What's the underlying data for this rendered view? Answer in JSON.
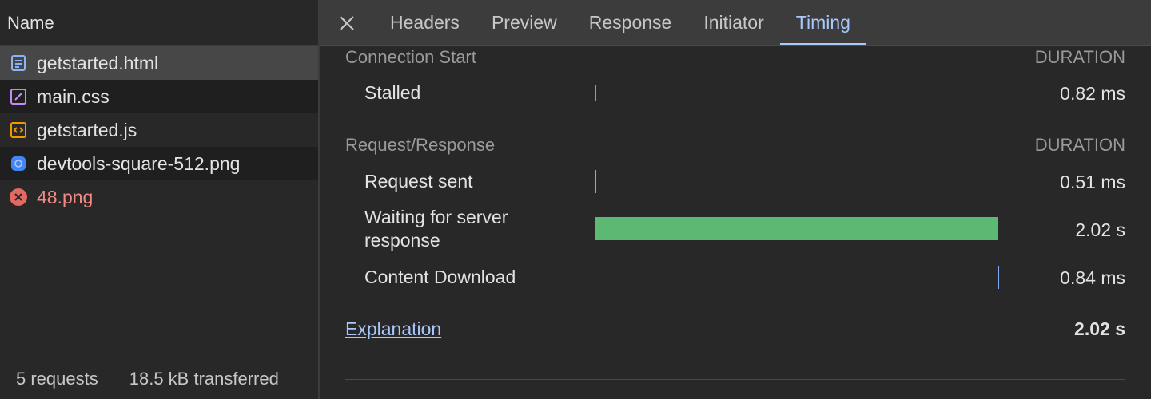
{
  "requests_panel": {
    "header": "Name",
    "items": [
      {
        "name": "getstarted.html",
        "icon": "document-icon",
        "icon_color": "#8ab4f8"
      },
      {
        "name": "main.css",
        "icon": "stylesheet-icon",
        "icon_color": "#c58af9"
      },
      {
        "name": "getstarted.js",
        "icon": "script-icon",
        "icon_color": "#f29900"
      },
      {
        "name": "devtools-square-512.png",
        "icon": "image-icon",
        "icon_color": "#4285f4"
      },
      {
        "name": "48.png",
        "icon": "error-icon",
        "icon_color": "#e46962",
        "error": true
      }
    ],
    "footer": {
      "requests": "5 requests",
      "transferred": "18.5 kB transferred"
    }
  },
  "tabs": [
    "Headers",
    "Preview",
    "Response",
    "Initiator",
    "Timing"
  ],
  "active_tab": "Timing",
  "timing": {
    "section1": {
      "label": "Connection Start",
      "duration_header": "DURATION"
    },
    "stalled": {
      "label": "Stalled",
      "value": "0.82 ms"
    },
    "section2": {
      "label": "Request/Response",
      "duration_header": "DURATION"
    },
    "request_sent": {
      "label": "Request sent",
      "value": "0.51 ms"
    },
    "waiting": {
      "label": "Waiting for server response",
      "value": "2.02 s",
      "bar_color": "#5bb974"
    },
    "content_download": {
      "label": "Content Download",
      "value": "0.84 ms"
    },
    "explanation_link": "Explanation",
    "total": "2.02 s"
  },
  "colors": {
    "accent": "#a8c7fa",
    "wait_bar": "#5bb974",
    "marker_blue": "#8ab4f8",
    "error": "#f28b82"
  }
}
